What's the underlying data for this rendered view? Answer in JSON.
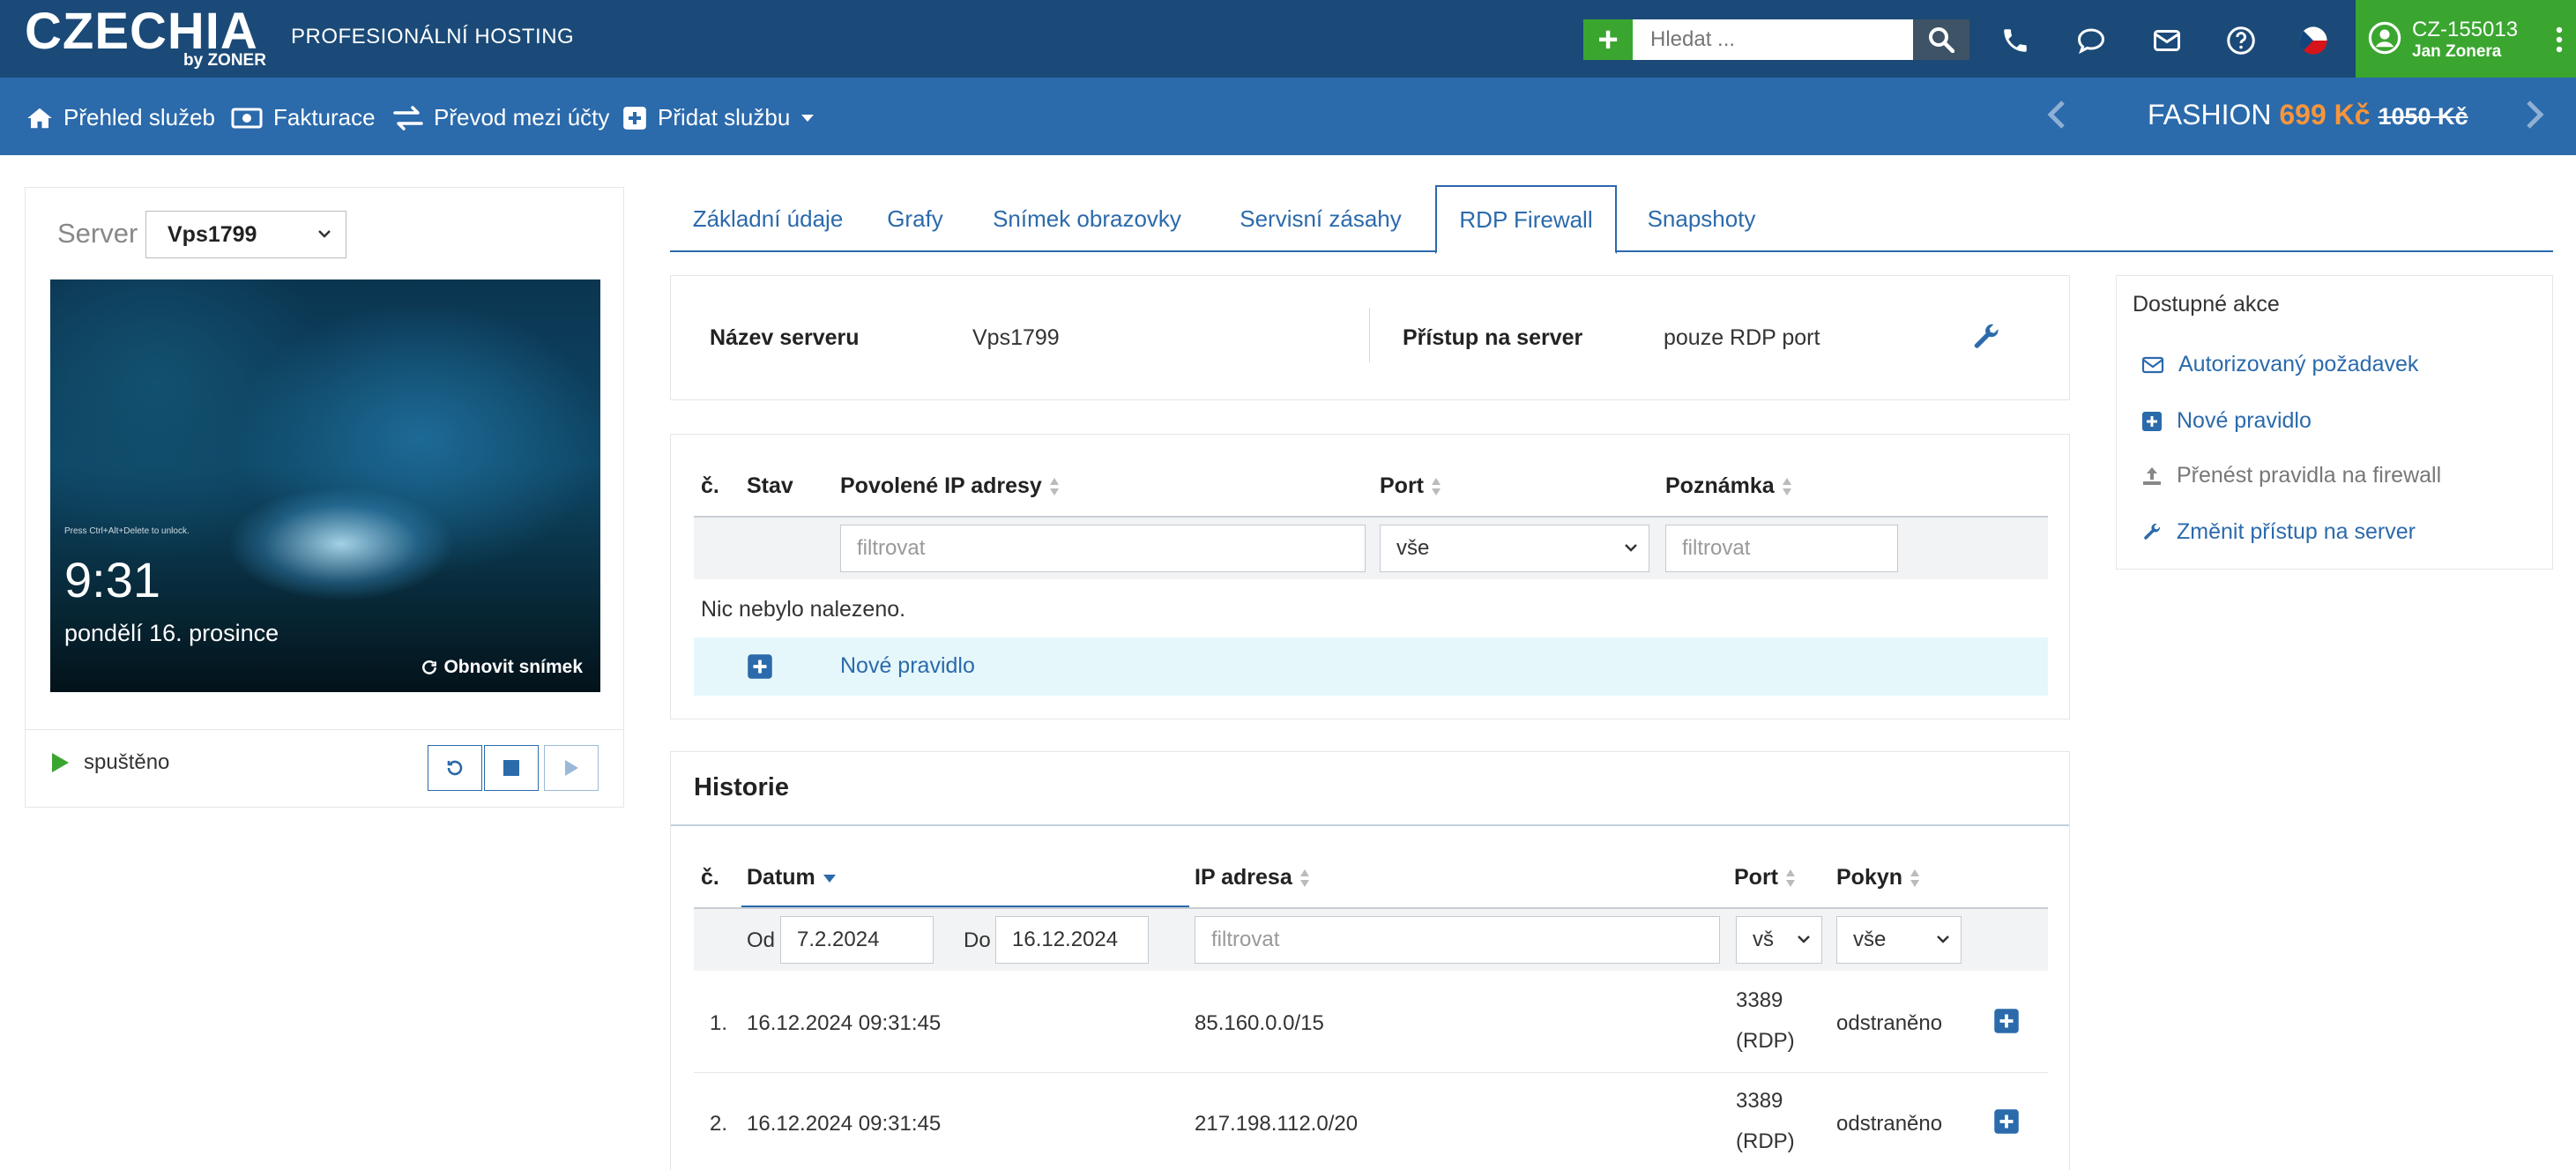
{
  "header": {
    "logo": "CZECHIA",
    "logo_sub": "by ZONER",
    "tagline": "PROFESIONÁLNÍ HOSTING",
    "search_placeholder": "Hledat ...",
    "account_id": "CZ-155013",
    "account_name": "Jan Zonera"
  },
  "nav": {
    "items": [
      {
        "label": "Přehled služeb",
        "icon": "home-icon"
      },
      {
        "label": "Fakturace",
        "icon": "money-icon"
      },
      {
        "label": "Převod mezi účty",
        "icon": "transfer-icon"
      },
      {
        "label": "Přidat službu",
        "icon": "plus-square-icon"
      }
    ],
    "promo_name": "FASHION",
    "promo_price": "699 Kč",
    "promo_old_price": "1050 Kč"
  },
  "server_panel": {
    "label": "Server",
    "selected": "Vps1799",
    "screenshot": {
      "hint": "Press Ctrl+Alt+Delete to unlock.",
      "time": "9:31",
      "date": "pondělí 16. prosince",
      "refresh_label": "Obnovit snímek"
    },
    "status": "spuštěno"
  },
  "tabs": [
    {
      "label": "Základní údaje",
      "active": false
    },
    {
      "label": "Grafy",
      "active": false
    },
    {
      "label": "Snímek obrazovky",
      "active": false
    },
    {
      "label": "Servisní zásahy",
      "active": false
    },
    {
      "label": "RDP Firewall",
      "active": true
    },
    {
      "label": "Snapshoty",
      "active": false
    }
  ],
  "info": {
    "name_label": "Název serveru",
    "name_value": "Vps1799",
    "access_label": "Přístup na server",
    "access_value": "pouze RDP port"
  },
  "rules": {
    "columns": [
      "č.",
      "Stav",
      "Povolené IP adresy",
      "Port",
      "Poznámka"
    ],
    "filter_ip_placeholder": "filtrovat",
    "filter_port_value": "vše",
    "filter_note_placeholder": "filtrovat",
    "empty_text": "Nic nebylo nalezeno.",
    "new_rule_label": "Nové pravidlo"
  },
  "history": {
    "title": "Historie",
    "columns": [
      "č.",
      "Datum",
      "IP adresa",
      "Port",
      "Pokyn"
    ],
    "from_label": "Od",
    "from_value": "7.2.2024",
    "to_label": "Do",
    "to_value": "16.12.2024",
    "ip_placeholder": "filtrovat",
    "port_value": "vš",
    "cmd_value": "vše",
    "rows": [
      {
        "num": "1.",
        "date": "16.12.2024 09:31:45",
        "ip": "85.160.0.0/15",
        "port1": "3389",
        "port2": "(RDP)",
        "cmd": "odstraněno"
      },
      {
        "num": "2.",
        "date": "16.12.2024 09:31:45",
        "ip": "217.198.112.0/20",
        "port1": "3389",
        "port2": "(RDP)",
        "cmd": "odstraněno"
      }
    ]
  },
  "actions": {
    "title": "Dostupné akce",
    "items": [
      {
        "label": "Autorizovaný požadavek",
        "icon": "envelope-icon",
        "enabled": true
      },
      {
        "label": "Nové pravidlo",
        "icon": "plus-square-icon",
        "enabled": true
      },
      {
        "label": "Přenést pravidla na firewall",
        "icon": "upload-icon",
        "enabled": false
      },
      {
        "label": "Změnit přístup na server",
        "icon": "wrench-icon",
        "enabled": true
      }
    ]
  },
  "colors": {
    "header_bg": "#1b4a78",
    "nav_bg": "#2b6aab",
    "accent_green": "#3aa630",
    "link_blue": "#2b6aab",
    "promo_orange": "#f7953b",
    "new_rule_bg": "#e6f7fb"
  }
}
